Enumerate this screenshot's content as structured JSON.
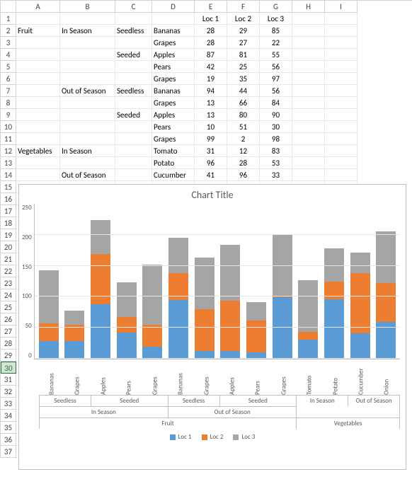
{
  "columns": [
    "A",
    "B",
    "C",
    "D",
    "E",
    "F",
    "G",
    "H",
    "I"
  ],
  "row_count": 37,
  "headers": {
    "E1": "Loc 1",
    "F1": "Loc 2",
    "G1": "Loc 3"
  },
  "rows": [
    {
      "r": 2,
      "A": "Fruit",
      "B": "In Season",
      "C": "Seedless",
      "D": "Bananas",
      "E": 28,
      "F": 29,
      "G": 85
    },
    {
      "r": 3,
      "D": "Grapes",
      "E": 28,
      "F": 27,
      "G": 22
    },
    {
      "r": 4,
      "C": "Seeded",
      "D": "Apples",
      "E": 87,
      "F": 81,
      "G": 55
    },
    {
      "r": 5,
      "D": "Pears",
      "E": 42,
      "F": 25,
      "G": 56
    },
    {
      "r": 6,
      "D": "Grapes",
      "E": 19,
      "F": 35,
      "G": 97
    },
    {
      "r": 7,
      "B": "Out of Season",
      "C": "Seedless",
      "D": "Bananas",
      "E": 94,
      "F": 44,
      "G": 56
    },
    {
      "r": 8,
      "D": "Grapes",
      "E": 13,
      "F": 66,
      "G": 84
    },
    {
      "r": 9,
      "C": "Seeded",
      "D": "Apples",
      "E": 13,
      "F": 80,
      "G": 90
    },
    {
      "r": 10,
      "D": "Pears",
      "E": 10,
      "F": 51,
      "G": 30
    },
    {
      "r": 11,
      "D": "Grapes",
      "E": 99,
      "F": 2,
      "G": 98
    },
    {
      "r": 12,
      "A": "Vegetables",
      "B": "In Season",
      "D": "Tomato",
      "E": 31,
      "F": 12,
      "G": 83
    },
    {
      "r": 13,
      "D": "Potato",
      "E": 96,
      "F": 28,
      "G": 53
    },
    {
      "r": 14,
      "B": "Out of Season",
      "D": "Cucumber",
      "E": 41,
      "F": 96,
      "G": 33
    },
    {
      "r": 15,
      "D": "Onion",
      "E": 59,
      "F": 63,
      "G": 83
    }
  ],
  "selected_row": 30,
  "chart_data": {
    "type": "bar",
    "stacked": true,
    "title": "Chart Title",
    "ylim": [
      0,
      250
    ],
    "yticks": [
      0,
      50,
      100,
      150,
      200,
      250
    ],
    "categories": [
      "Bananas",
      "Grapes",
      "Apples",
      "Pears",
      "Grapes",
      "Bananas",
      "Grapes",
      "Apples",
      "Pears",
      "Grapes",
      "Tomato",
      "Potato",
      "Cucumber",
      "Onion"
    ],
    "series": [
      {
        "name": "Loc 1",
        "color": "#5b9bd5",
        "values": [
          28,
          28,
          87,
          42,
          19,
          94,
          13,
          13,
          10,
          99,
          31,
          96,
          41,
          59
        ]
      },
      {
        "name": "Loc 2",
        "color": "#ed7d31",
        "values": [
          29,
          27,
          81,
          25,
          35,
          44,
          66,
          80,
          51,
          2,
          12,
          28,
          96,
          63
        ]
      },
      {
        "name": "Loc 3",
        "color": "#a5a5a5",
        "values": [
          85,
          22,
          55,
          56,
          97,
          56,
          84,
          90,
          30,
          98,
          83,
          53,
          33,
          83
        ]
      }
    ],
    "hier_level3": [
      {
        "label": "Seedless",
        "span": 2
      },
      {
        "label": "Seeded",
        "span": 3
      },
      {
        "label": "Seedless",
        "span": 2
      },
      {
        "label": "Seeded",
        "span": 3
      },
      {
        "label": "In Season",
        "span": 2
      },
      {
        "label": "Out of Season",
        "span": 2
      }
    ],
    "hier_level2": [
      {
        "label": "In Season",
        "span": 5
      },
      {
        "label": "Out of Season",
        "span": 5
      },
      {
        "label": "",
        "span": 4
      }
    ],
    "hier_level1": [
      {
        "label": "Fruit",
        "span": 10
      },
      {
        "label": "Vegetables",
        "span": 4
      }
    ]
  }
}
